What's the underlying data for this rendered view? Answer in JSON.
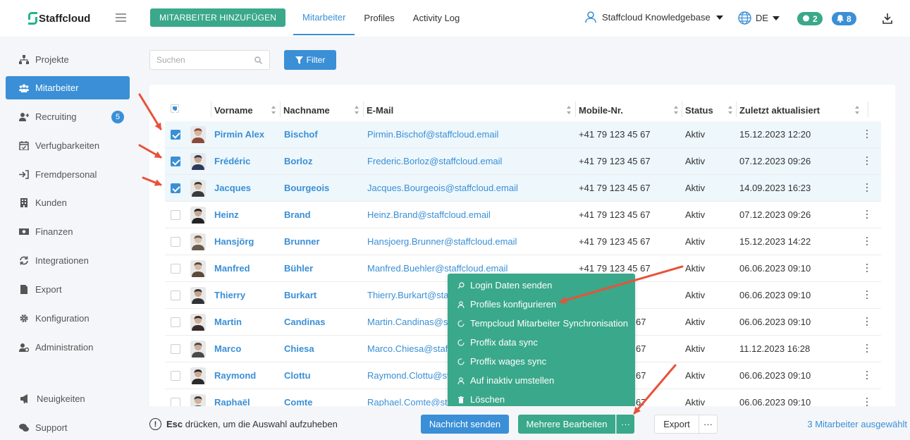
{
  "app": {
    "name": "Staffcloud"
  },
  "header": {
    "add_button": "MITARBEITER HINZUFÜGEN",
    "tabs": [
      {
        "label": "Mitarbeiter",
        "active": true
      },
      {
        "label": "Profiles",
        "active": false
      },
      {
        "label": "Activity Log",
        "active": false
      }
    ],
    "account": "Staffcloud Knowledgebase",
    "language": "DE",
    "messages_count": "2",
    "notifications_count": "8"
  },
  "sidebar": {
    "items": [
      {
        "label": "Projekte",
        "icon": "sitemap-icon"
      },
      {
        "label": "Mitarbeiter",
        "icon": "users-icon",
        "active": true
      },
      {
        "label": "Recruiting",
        "icon": "user-plus-icon",
        "badge": "5"
      },
      {
        "label": "Verfugbarkeiten",
        "icon": "calendar-check-icon"
      },
      {
        "label": "Fremdpersonal",
        "icon": "sign-in-icon"
      },
      {
        "label": "Kunden",
        "icon": "building-icon"
      },
      {
        "label": "Finanzen",
        "icon": "money-icon"
      },
      {
        "label": "Integrationen",
        "icon": "sync-icon"
      },
      {
        "label": "Export",
        "icon": "file-export-icon"
      },
      {
        "label": "Konfiguration",
        "icon": "gear-icon"
      },
      {
        "label": "Administration",
        "icon": "user-cog-icon"
      }
    ],
    "bottom_items": [
      {
        "label": "Neuigkeiten",
        "icon": "megaphone-icon"
      },
      {
        "label": "Support",
        "icon": "comments-icon"
      }
    ]
  },
  "toolbar": {
    "search_placeholder": "Suchen",
    "filter_label": "Filter"
  },
  "table": {
    "columns": [
      "Vorname",
      "Nachname",
      "E-Mail",
      "Mobile-Nr.",
      "Status",
      "Zuletzt aktualisiert"
    ],
    "rows": [
      {
        "first": "Pirmin Alex",
        "last": "Bischof",
        "email": "Pirmin.Bischof@staffcloud.email",
        "phone": "+41 79 123 45 67",
        "status": "Aktiv",
        "updated": "15.12.2023 12:20",
        "selected": true
      },
      {
        "first": "Frédéric",
        "last": "Borloz",
        "email": "Frederic.Borloz@staffcloud.email",
        "phone": "+41 79 123 45 67",
        "status": "Aktiv",
        "updated": "07.12.2023 09:26",
        "selected": true
      },
      {
        "first": "Jacques",
        "last": "Bourgeois",
        "email": "Jacques.Bourgeois@staffcloud.email",
        "phone": "+41 79 123 45 67",
        "status": "Aktiv",
        "updated": "14.09.2023 16:23",
        "selected": true
      },
      {
        "first": "Heinz",
        "last": "Brand",
        "email": "Heinz.Brand@staffcloud.email",
        "phone": "+41 79 123 45 67",
        "status": "Aktiv",
        "updated": "07.12.2023 09:26",
        "selected": false
      },
      {
        "first": "Hansjörg",
        "last": "Brunner",
        "email": "Hansjoerg.Brunner@staffcloud.email",
        "phone": "+41 79 123 45 67",
        "status": "Aktiv",
        "updated": "15.12.2023 14:22",
        "selected": false
      },
      {
        "first": "Manfred",
        "last": "Bühler",
        "email": "Manfred.Buehler@staffcloud.email",
        "phone": "+41 79 123 45 67",
        "status": "Aktiv",
        "updated": "06.06.2023 09:10",
        "selected": false
      },
      {
        "first": "Thierry",
        "last": "Burkart",
        "email": "Thierry.Burkart@staf",
        "phone": "",
        "status": "Aktiv",
        "updated": "06.06.2023 09:10",
        "selected": false
      },
      {
        "first": "Martin",
        "last": "Candinas",
        "email": "Martin.Candinas@sta",
        "phone": "67",
        "status": "Aktiv",
        "updated": "06.06.2023 09:10",
        "selected": false
      },
      {
        "first": "Marco",
        "last": "Chiesa",
        "email": "Marco.Chiesa@staffc",
        "phone": "67",
        "status": "Aktiv",
        "updated": "11.12.2023 16:28",
        "selected": false
      },
      {
        "first": "Raymond",
        "last": "Clottu",
        "email": "Raymond.Clottu@sta",
        "phone": "67",
        "status": "Aktiv",
        "updated": "06.06.2023 09:10",
        "selected": false
      },
      {
        "first": "Raphaël",
        "last": "Comte",
        "email": "Raphael.Comte@sta",
        "phone": "67",
        "status": "Aktiv",
        "updated": "06.06.2023 09:10",
        "selected": false
      }
    ]
  },
  "context_menu": {
    "items": [
      {
        "label": "Login Daten senden",
        "icon": "search-icon"
      },
      {
        "label": "Profiles konfigurieren",
        "icon": "user-icon"
      },
      {
        "label": "Tempcloud Mitarbeiter Synchronisation",
        "icon": "circle-icon"
      },
      {
        "label": "Proffix data sync",
        "icon": "circle-icon"
      },
      {
        "label": "Proffix wages sync",
        "icon": "circle-icon"
      },
      {
        "label": "Auf inaktiv umstellen",
        "icon": "user-icon"
      },
      {
        "label": "Löschen",
        "icon": "trash-icon"
      }
    ]
  },
  "footer": {
    "esc_key": "Esc",
    "esc_text": "drücken, um die Auswahl aufzuheben",
    "send_message": "Nachricht senden",
    "bulk_edit": "Mehrere Bearbeiten",
    "more": "···",
    "export": "Export",
    "selected_text": "3 Mitarbeiter ausgewählt"
  },
  "colors": {
    "primary_blue": "#3a8fd6",
    "brand_green": "#3aa88a",
    "annotation_red": "#e8523a"
  }
}
